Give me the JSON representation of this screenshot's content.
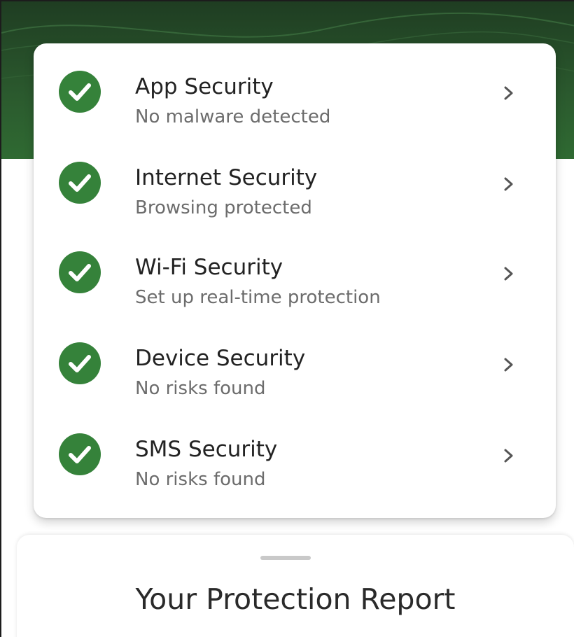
{
  "theme": {
    "header_green": "#2b5a2e",
    "check_green": "#35823a",
    "title_color": "#222222",
    "subtitle_color": "#6c6c6c"
  },
  "security_items": [
    {
      "title": "App Security",
      "status": "No malware detected",
      "icon": "check-circle-icon"
    },
    {
      "title": "Internet Security",
      "status": "Browsing protected",
      "icon": "check-circle-icon"
    },
    {
      "title": "Wi-Fi Security",
      "status": "Set up real-time protection",
      "icon": "check-circle-icon"
    },
    {
      "title": "Device Security",
      "status": "No risks found",
      "icon": "check-circle-icon"
    },
    {
      "title": "SMS Security",
      "status": "No risks found",
      "icon": "check-circle-icon"
    }
  ],
  "report": {
    "title": "Your Protection Report"
  }
}
